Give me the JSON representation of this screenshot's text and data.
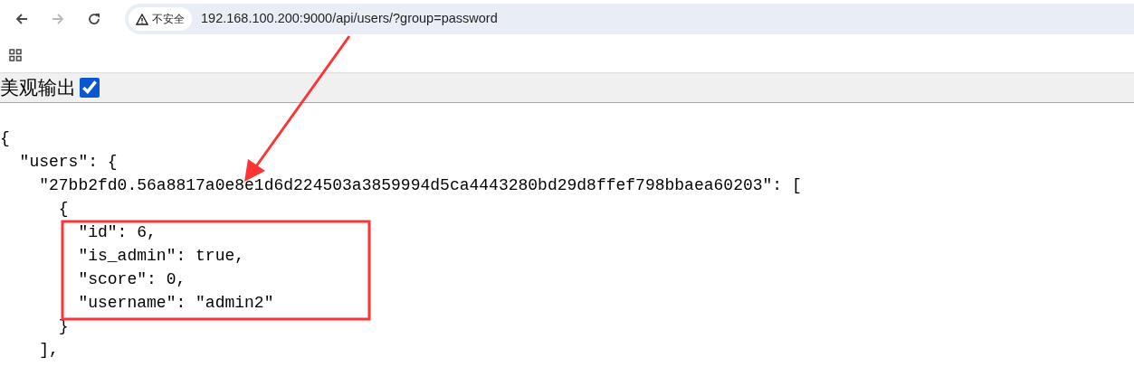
{
  "browser": {
    "nav_buttons": [
      {
        "kind": "back",
        "disabled": false
      },
      {
        "kind": "forward",
        "disabled": true
      },
      {
        "kind": "reload",
        "disabled": false
      }
    ],
    "security_label": "不安全",
    "url": "192.168.100.200:9000/api/users/?group=password"
  },
  "pretty_print": {
    "label": "美观输出",
    "checked": true
  },
  "code_lines": [
    "{",
    "  \"users\": {",
    "    \"27bb2fd0.56a8817a0e8e1d6d224503a3859994d5ca4443280bd29d8ffef798bbaea60203\": [",
    "      {",
    "        \"id\": 6,",
    "        \"is_admin\": true,",
    "        \"score\": 0,",
    "        \"username\": \"admin2\"",
    "      }",
    "    ],"
  ]
}
